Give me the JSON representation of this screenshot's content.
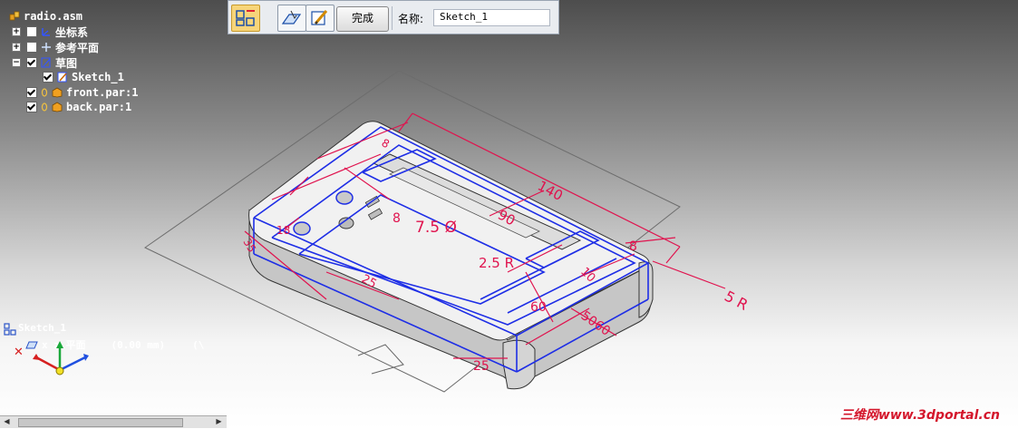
{
  "tree": {
    "root": "radio.asm",
    "items": [
      {
        "label": "坐标系",
        "checked": false,
        "expand": "+"
      },
      {
        "label": "参考平面",
        "checked": false,
        "expand": "+"
      },
      {
        "label": "草图",
        "checked": true,
        "expand": "−"
      },
      {
        "label": "Sketch_1",
        "checked": true
      },
      {
        "label": "front.par:1",
        "checked": true
      },
      {
        "label": "back.par:1",
        "checked": true
      }
    ]
  },
  "toolbar": {
    "done_label": "完成",
    "name_label": "名称:",
    "name_value": "Sketch_1"
  },
  "triad": {
    "sketch_label": "Sketch_1",
    "plane_label": "x  z 平面",
    "coords": "(0.00 mm)",
    "trailing": "(\\"
  },
  "dimensions": {
    "d140": "140",
    "d90": "90",
    "d75": "7.5 Ø",
    "d25r": "2.5 R",
    "d5r": "5 R",
    "d8": "8",
    "d60": "60",
    "d5060": "5060",
    "d25a": "25",
    "d25b": "25",
    "d10": "10",
    "d8b": "8",
    "d35": "35",
    "d18": "18",
    "d8c": "8"
  },
  "watermark": "三维网www.3dportal.cn",
  "colors": {
    "sketch_line": "#1e2ee6",
    "dimension": "#e0134e",
    "body_top": "#f4f4f4",
    "body_side": "#cfcfcf"
  }
}
